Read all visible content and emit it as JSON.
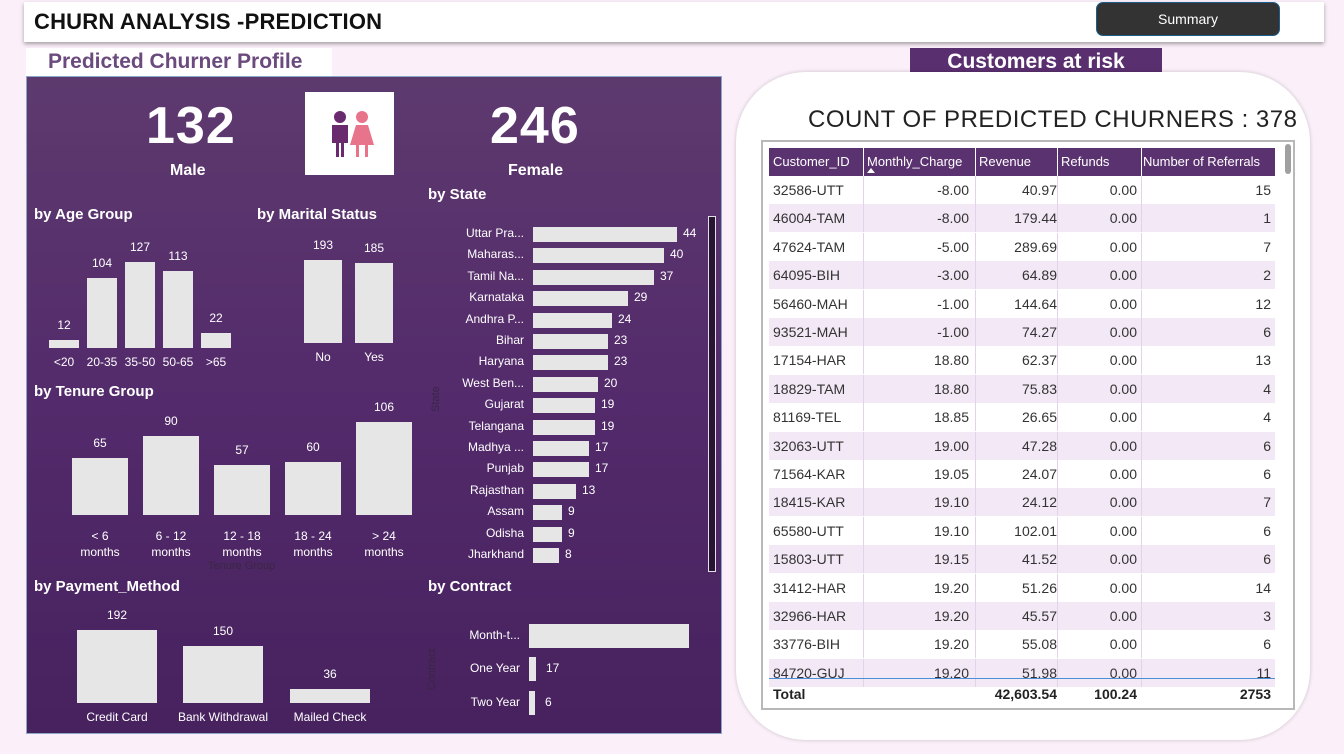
{
  "header": {
    "title": "CHURN ANALYSIS -PREDICTION",
    "summary_button": "Summary"
  },
  "profile": {
    "title": "Predicted Churner Profile",
    "male_count": "132",
    "male_label": "Male",
    "female_count": "246",
    "female_label": "Female",
    "age": {
      "title": "by Age Group",
      "categories": [
        "<20",
        "20-35",
        "35-50",
        "50-65",
        ">65"
      ],
      "values": [
        12,
        104,
        127,
        113,
        22
      ]
    },
    "marital": {
      "title": "by Marital Status",
      "categories": [
        "No",
        "Yes"
      ],
      "values": [
        193,
        185
      ]
    },
    "tenure": {
      "title": "by Tenure Group",
      "categories": [
        [
          "< 6",
          "months"
        ],
        [
          "6 - 12",
          "months"
        ],
        [
          "12 - 18",
          "months"
        ],
        [
          "18 - 24",
          "months"
        ],
        [
          "> 24",
          "months"
        ]
      ],
      "values": [
        65,
        90,
        57,
        60,
        106
      ],
      "axis_title": "Tenure Group"
    },
    "payment": {
      "title": "by Payment_Method",
      "categories": [
        "Credit Card",
        "Bank Withdrawal",
        "Mailed Check"
      ],
      "values": [
        192,
        150,
        36
      ]
    },
    "state": {
      "title": "by State",
      "axis_title": "State",
      "categories": [
        "Uttar Pra...",
        "Maharas...",
        "Tamil Na...",
        "Karnataka",
        "Andhra P...",
        "Bihar",
        "Haryana",
        "West Ben...",
        "Gujarat",
        "Telangana",
        "Madhya ...",
        "Punjab",
        "Rajasthan",
        "Assam",
        "Odisha",
        "Jharkhand"
      ],
      "values": [
        44,
        40,
        37,
        29,
        24,
        23,
        23,
        20,
        19,
        19,
        17,
        17,
        13,
        9,
        9,
        8
      ]
    },
    "contract": {
      "title": "by Contract",
      "axis_title": "Contract",
      "categories": [
        "Month-t...",
        "One Year",
        "Two Year"
      ],
      "values": [
        null,
        17,
        6
      ],
      "bar_values": [
        378,
        17,
        6
      ]
    }
  },
  "risk": {
    "title": "Customers at risk",
    "count_title": "COUNT OF PREDICTED CHURNERS : 378",
    "columns": [
      "Customer_ID",
      "Monthly_Charge",
      "Revenue",
      "Refunds",
      "Number of Referrals"
    ],
    "rows": [
      [
        "32586-UTT",
        "-8.00",
        "40.97",
        "0.00",
        "15"
      ],
      [
        "46004-TAM",
        "-8.00",
        "179.44",
        "0.00",
        "1"
      ],
      [
        "47624-TAM",
        "-5.00",
        "289.69",
        "0.00",
        "7"
      ],
      [
        "64095-BIH",
        "-3.00",
        "64.89",
        "0.00",
        "2"
      ],
      [
        "56460-MAH",
        "-1.00",
        "144.64",
        "0.00",
        "12"
      ],
      [
        "93521-MAH",
        "-1.00",
        "74.27",
        "0.00",
        "6"
      ],
      [
        "17154-HAR",
        "18.80",
        "62.37",
        "0.00",
        "13"
      ],
      [
        "18829-TAM",
        "18.80",
        "75.83",
        "0.00",
        "4"
      ],
      [
        "81169-TEL",
        "18.85",
        "26.65",
        "0.00",
        "4"
      ],
      [
        "32063-UTT",
        "19.00",
        "47.28",
        "0.00",
        "6"
      ],
      [
        "71564-KAR",
        "19.05",
        "24.07",
        "0.00",
        "6"
      ],
      [
        "18415-KAR",
        "19.10",
        "24.12",
        "0.00",
        "7"
      ],
      [
        "65580-UTT",
        "19.10",
        "102.01",
        "0.00",
        "6"
      ],
      [
        "15803-UTT",
        "19.15",
        "41.52",
        "0.00",
        "6"
      ],
      [
        "31412-HAR",
        "19.20",
        "51.26",
        "0.00",
        "14"
      ],
      [
        "32966-HAR",
        "19.20",
        "45.57",
        "0.00",
        "3"
      ],
      [
        "33776-BIH",
        "19.20",
        "55.08",
        "0.00",
        "6"
      ],
      [
        "84720-GUJ",
        "19.20",
        "51.98",
        "0.00",
        "11"
      ]
    ],
    "total": {
      "label": "Total",
      "revenue": "42,603.54",
      "refunds": "100.24",
      "referrals": "2753"
    }
  }
}
